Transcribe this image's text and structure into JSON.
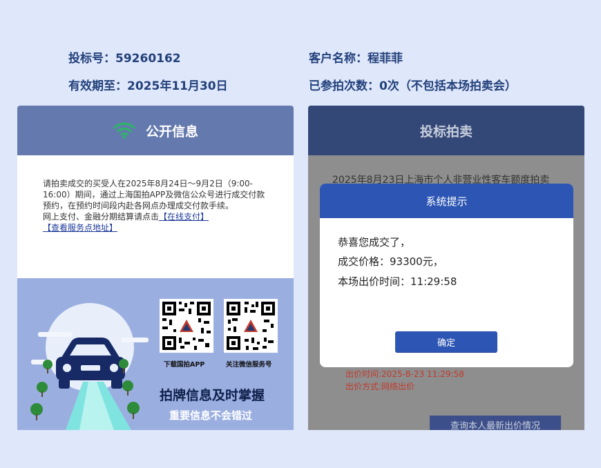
{
  "account": {
    "bid_no": "投标号：59260162",
    "valid_until": "有效期至：2025年11月30日",
    "customer": "客户名称：程菲菲",
    "attempts": "已参拍次数：0次（不包括本场拍卖会）"
  },
  "public_info": {
    "title": "公开信息",
    "notice": "请拍卖成交的买受人在2025年8月24日～9月2日（9:00-16:00）期间，通过上海国拍APP及微信公众号进行成交付款预约，在预约时间段内赴各网点办理成交付款手续。",
    "pay_prefix": "网上支付、金融分期结算请点击",
    "pay_link": "【在线支付】",
    "address_link": "【查看服务点地址】"
  },
  "promo": {
    "qr1_label": "下载国拍APP",
    "qr2_label": "关注微信服务号",
    "slogan_main": "拍牌信息及时掌握",
    "slogan_sub": "重要信息不会错过"
  },
  "auction": {
    "title": "投标拍卖",
    "session": "2025年8月23日上海市个人非营业性客车额度拍卖",
    "bid_time": "出价时间:2025-8-23 11:29:58",
    "bid_method": "出价方式:网络出价",
    "query_button": "查询本人最新出价情况"
  },
  "dialog": {
    "title": "系统提示",
    "line1": "恭喜您成交了，",
    "line2": "成交价格：93300元，",
    "line3": "本场出价时间：11:29:58",
    "ok": "确定"
  },
  "colors": {
    "brand_blue": "#2d55b3",
    "header_left": "#6479ad",
    "header_right": "#344878",
    "wifi_green": "#2fb36a"
  }
}
